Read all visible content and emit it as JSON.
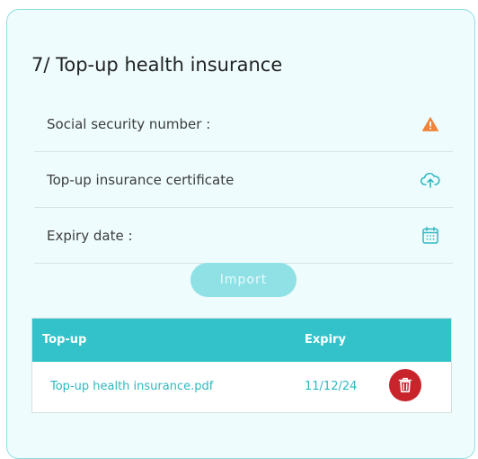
{
  "section": {
    "title": "7/ Top-up health insurance"
  },
  "fields": [
    {
      "label": "Social security number :",
      "icon": "warning-icon",
      "icon_color": "#f0843a"
    },
    {
      "label": "Top-up insurance certificate",
      "icon": "cloud-upload-icon",
      "icon_color": "#2fb8c0"
    },
    {
      "label": "Expiry date :",
      "icon": "calendar-icon",
      "icon_color": "#2fb8c0"
    }
  ],
  "import_button": {
    "label": "Import"
  },
  "table": {
    "headers": [
      "Top-up",
      "Expiry"
    ],
    "rows": [
      {
        "file": "Top-up health insurance.pdf",
        "expiry": "11/12/24"
      }
    ]
  },
  "colors": {
    "accent": "#33c2c9",
    "link": "#2fb8c0",
    "danger": "#c8242b",
    "warning": "#f0843a",
    "card_background": "#eefcfd"
  }
}
